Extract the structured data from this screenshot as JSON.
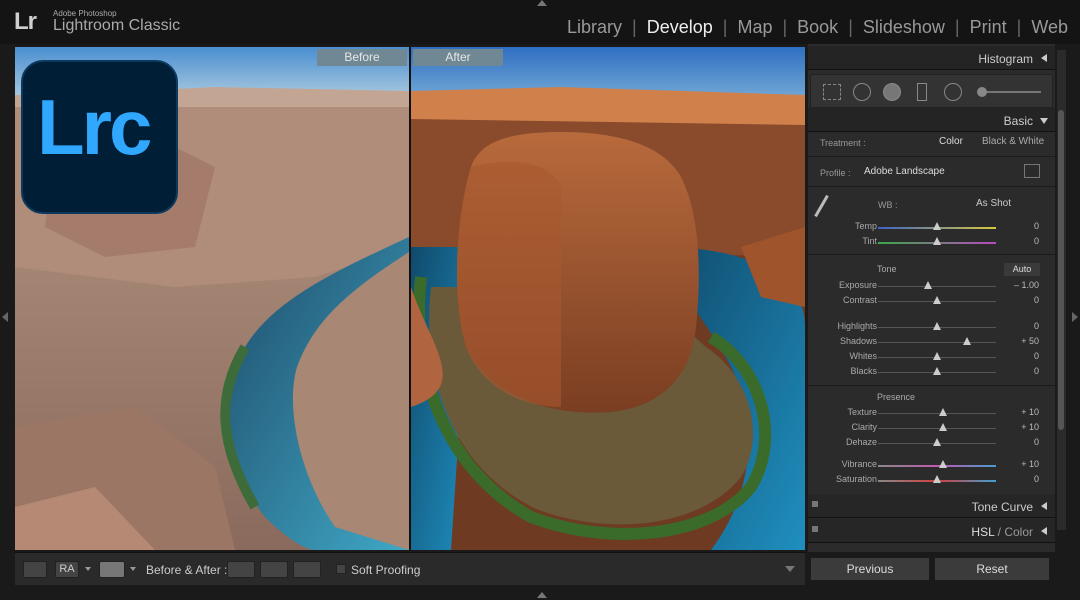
{
  "app": {
    "brand_mark": "Lr",
    "brand_small": "Adobe Photoshop",
    "brand_name": "Lightroom Classic",
    "badge": "Lrc"
  },
  "modules": [
    "Library",
    "Develop",
    "Map",
    "Book",
    "Slideshow",
    "Print",
    "Web"
  ],
  "active_module": "Develop",
  "viewer": {
    "before_label": "Before",
    "after_label": "After"
  },
  "toolbar": {
    "before_after_label": "Before & After :",
    "soft_proofing_label": "Soft Proofing"
  },
  "panels": {
    "histogram": "Histogram",
    "basic": "Basic",
    "tone_curve": "Tone Curve",
    "hsl_prefix": "HSL",
    "hsl_suffix": "/ Color"
  },
  "basic": {
    "treatment_label": "Treatment :",
    "treatment_color": "Color",
    "treatment_bw": "Black & White",
    "profile_label": "Profile :",
    "profile_value": "Adobe Landscape",
    "wb_label": "WB :",
    "wb_value": "As Shot",
    "tone_label": "Tone",
    "auto_label": "Auto",
    "presence_label": "Presence",
    "sliders": [
      {
        "label": "Temp",
        "value": "0",
        "pos": 0.5,
        "color": "temp"
      },
      {
        "label": "Tint",
        "value": "0",
        "pos": 0.5,
        "color": "tint"
      },
      {
        "label": "Exposure",
        "value": "– 1.00",
        "pos": 0.42
      },
      {
        "label": "Contrast",
        "value": "0",
        "pos": 0.5
      },
      {
        "label": "Highlights",
        "value": "0",
        "pos": 0.5
      },
      {
        "label": "Shadows",
        "value": "+ 50",
        "pos": 0.75
      },
      {
        "label": "Whites",
        "value": "0",
        "pos": 0.5
      },
      {
        "label": "Blacks",
        "value": "0",
        "pos": 0.5
      },
      {
        "label": "Texture",
        "value": "+ 10",
        "pos": 0.55
      },
      {
        "label": "Clarity",
        "value": "+ 10",
        "pos": 0.55
      },
      {
        "label": "Dehaze",
        "value": "0",
        "pos": 0.5
      },
      {
        "label": "Vibrance",
        "value": "+ 10",
        "pos": 0.55,
        "color": "vib"
      },
      {
        "label": "Saturation",
        "value": "0",
        "pos": 0.5,
        "color": "sat"
      }
    ]
  },
  "buttons": {
    "previous": "Previous",
    "reset": "Reset"
  },
  "colors": {
    "accent": "#31a8ff",
    "badge_bg": "#001e36",
    "label_bg": "#6f8893"
  }
}
